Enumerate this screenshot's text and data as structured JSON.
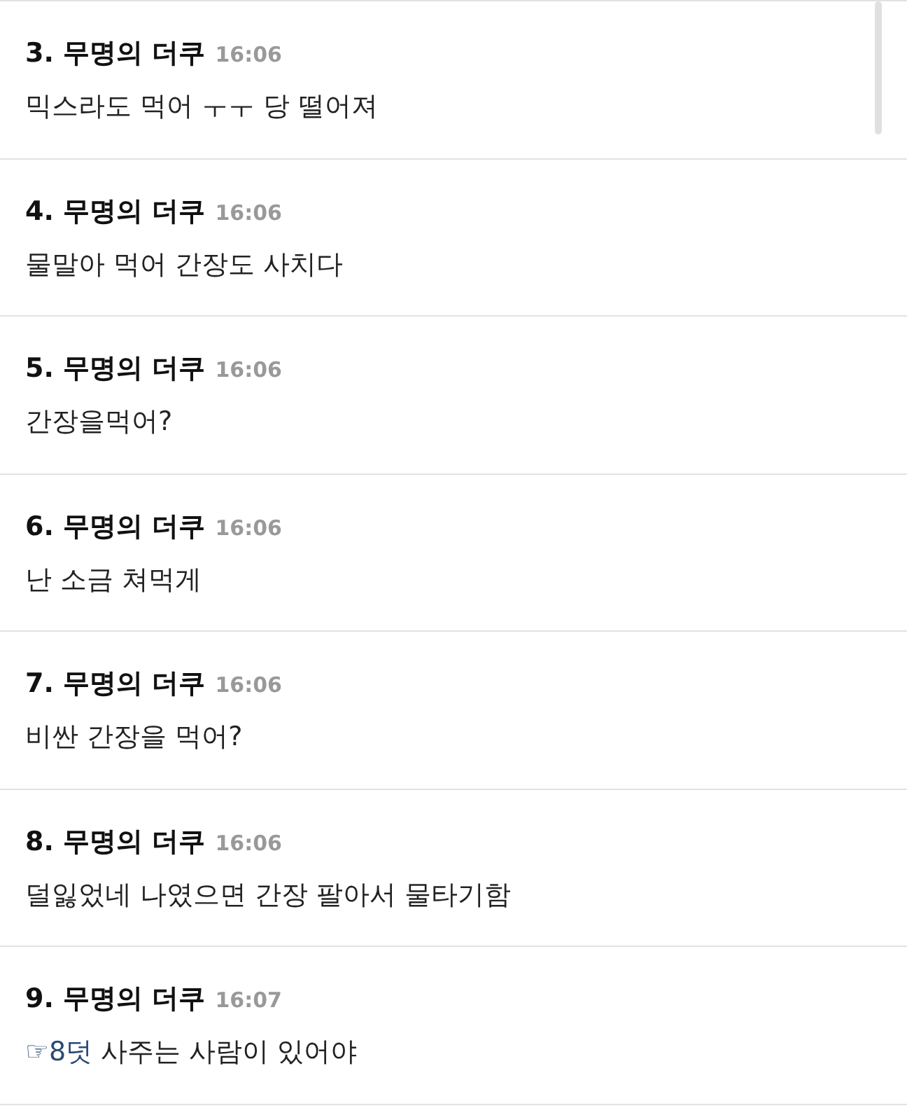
{
  "comments": [
    {
      "number": "3.",
      "author": "무명의 더쿠",
      "time": "16:06",
      "text": "믹스라도 먹어 ㅜㅜ 당 떨어져"
    },
    {
      "number": "4.",
      "author": "무명의 더쿠",
      "time": "16:06",
      "text": "물말아 먹어 간장도 사치다"
    },
    {
      "number": "5.",
      "author": "무명의 더쿠",
      "time": "16:06",
      "text": "간장을먹어?"
    },
    {
      "number": "6.",
      "author": "무명의 더쿠",
      "time": "16:06",
      "text": "난 소금 쳐먹게"
    },
    {
      "number": "7.",
      "author": "무명의 더쿠",
      "time": "16:06",
      "text": "비싼 간장을 먹어?"
    },
    {
      "number": "8.",
      "author": "무명의 더쿠",
      "time": "16:06",
      "text": "덜잃었네 나였으면 간장 팔아서 물타기함"
    },
    {
      "number": "9.",
      "author": "무명의 더쿠",
      "time": "16:07",
      "reply_link": "☞8덧",
      "text": "사주는 사람이 있어야"
    }
  ]
}
